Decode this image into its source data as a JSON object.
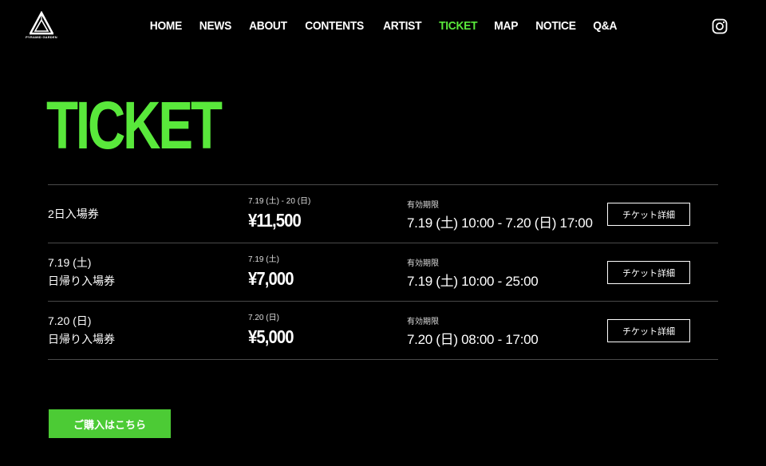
{
  "header": {
    "logo_text": "PYRAMID GARDEN",
    "logo_icon": "pyramid-logo-icon",
    "nav": [
      {
        "label": "HOME",
        "active": false
      },
      {
        "label": "NEWS",
        "active": false
      },
      {
        "label": "ABOUT",
        "active": false
      },
      {
        "label": "CONTENTS",
        "active": false
      },
      {
        "label": "ARTIST",
        "active": false
      },
      {
        "label": "TICKET",
        "active": true
      },
      {
        "label": "MAP",
        "active": false
      },
      {
        "label": "NOTICE",
        "active": false
      },
      {
        "label": "Q&A",
        "active": false
      }
    ],
    "social_icon": "instagram-icon"
  },
  "page": {
    "title": "TICKET",
    "tickets": [
      {
        "name_line1": "",
        "name_line2": "2日入場券",
        "price_date": "7.19 (土) - 20 (日)",
        "price": "¥11,500",
        "valid_label": "有効期限",
        "valid_text": "7.19 (土) 10:00 - 7.20 (日) 17:00",
        "detail_label": "チケット詳細"
      },
      {
        "name_line1": "7.19 (土)",
        "name_line2": "日帰り入場券",
        "price_date": "7.19 (土)",
        "price": "¥7,000",
        "valid_label": "有効期限",
        "valid_text": "7.19 (土) 10:00 - 25:00",
        "detail_label": "チケット詳細"
      },
      {
        "name_line1": "7.20 (日)",
        "name_line2": "日帰り入場券",
        "price_date": "7.20 (日)",
        "price": "¥5,000",
        "valid_label": "有効期限",
        "valid_text": "7.20 (日) 08:00 - 17:00",
        "detail_label": "チケット詳細"
      }
    ],
    "buy_label": "ご購入はこちら"
  },
  "colors": {
    "accent": "#59e83b",
    "button_green": "#4ccb35",
    "background": "#000000",
    "divider": "#4a4a4a"
  }
}
